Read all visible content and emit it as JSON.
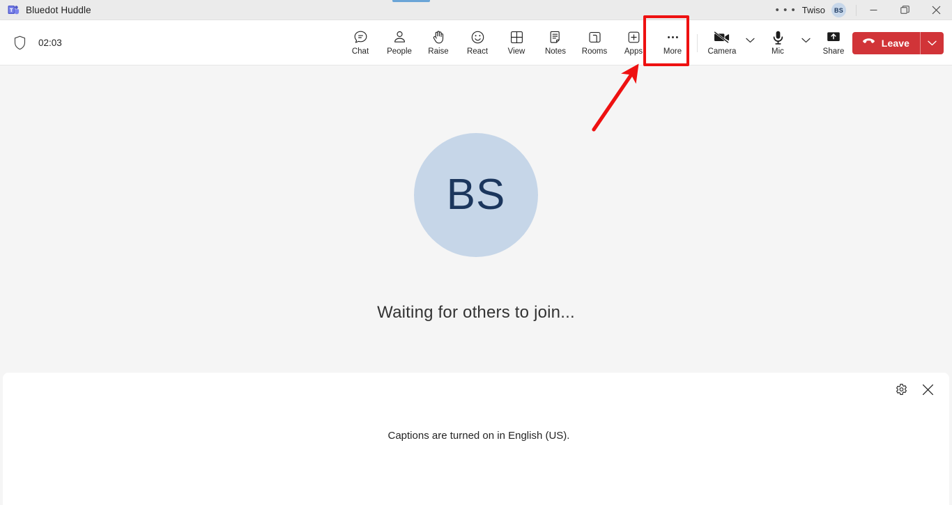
{
  "window": {
    "title": "Bluedot Huddle",
    "app_icon": "teams-logo-icon",
    "overflow_icon": "ellipsis-icon",
    "user_name": "Twiso",
    "user_initials": "BS",
    "minimize_label": "Minimize",
    "maximize_label": "Restore",
    "close_label": "Close"
  },
  "toolbar": {
    "shield_icon": "shield-icon",
    "timer": "02:03",
    "items": [
      {
        "label": "Chat",
        "icon": "chat-icon"
      },
      {
        "label": "People",
        "icon": "people-icon"
      },
      {
        "label": "Raise",
        "icon": "raise-hand-icon"
      },
      {
        "label": "React",
        "icon": "react-smiley-icon"
      },
      {
        "label": "View",
        "icon": "view-grid-icon"
      },
      {
        "label": "Notes",
        "icon": "notes-icon"
      },
      {
        "label": "Rooms",
        "icon": "rooms-icon"
      },
      {
        "label": "Apps",
        "icon": "apps-plus-icon"
      },
      {
        "label": "More",
        "icon": "more-ellipsis-icon"
      }
    ],
    "devices": [
      {
        "label": "Camera",
        "icon": "camera-off-icon",
        "state": "off"
      },
      {
        "label": "Mic",
        "icon": "microphone-icon",
        "state": "on"
      },
      {
        "label": "Share",
        "icon": "share-screen-icon",
        "state": "on"
      }
    ],
    "leave": {
      "label": "Leave",
      "icon": "hangup-phone-icon",
      "color": "#d13438",
      "chevron_icon": "chevron-down-icon"
    }
  },
  "stage": {
    "avatar_initials": "BS",
    "avatar_color": "#c6d6e8",
    "avatar_text_color": "#1b365d",
    "status_text": "Waiting for others to join..."
  },
  "captions": {
    "message": "Captions are turned on in English (US).",
    "settings_icon": "gear-icon",
    "close_icon": "close-icon"
  },
  "annotation": {
    "highlight_target": "More",
    "highlight_color": "#ee1111",
    "arrow_color": "#ee1111"
  }
}
